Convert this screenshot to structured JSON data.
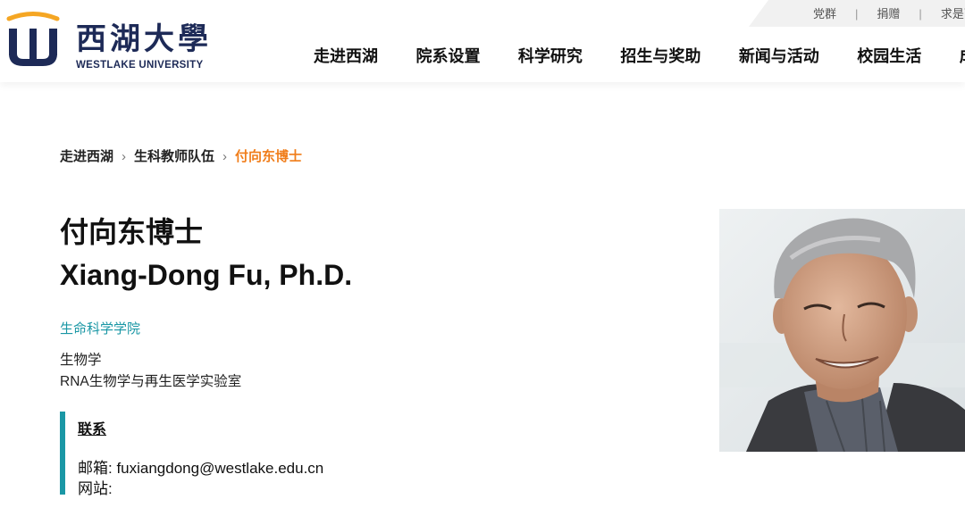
{
  "header": {
    "logo_cn": "西湖大學",
    "logo_en": "WESTLAKE UNIVERSITY",
    "top_links": [
      "党群",
      "捐赠",
      "求是西"
    ],
    "nav": [
      "走进西湖",
      "院系设置",
      "科学研究",
      "招生与奖助",
      "新闻与活动",
      "校园生活",
      "成"
    ]
  },
  "breadcrumb": {
    "items": [
      "走进西湖",
      "生科教师队伍"
    ],
    "current": "付向东博士"
  },
  "profile": {
    "name_cn": "付向东博士",
    "name_en": "Xiang-Dong Fu, Ph.D.",
    "school": "生命科学学院",
    "field": "生物学",
    "lab": "RNA生物学与再生医学实验室",
    "contact_title": "联系",
    "email_line": "邮箱: fuxiangdong@westlake.edu.cn",
    "website_line": "网站:"
  },
  "colors": {
    "brand_navy": "#1d2a57",
    "brand_orange": "#f5a623",
    "accent_teal": "#1a97a5",
    "breadcrumb_current": "#f07d1a"
  }
}
